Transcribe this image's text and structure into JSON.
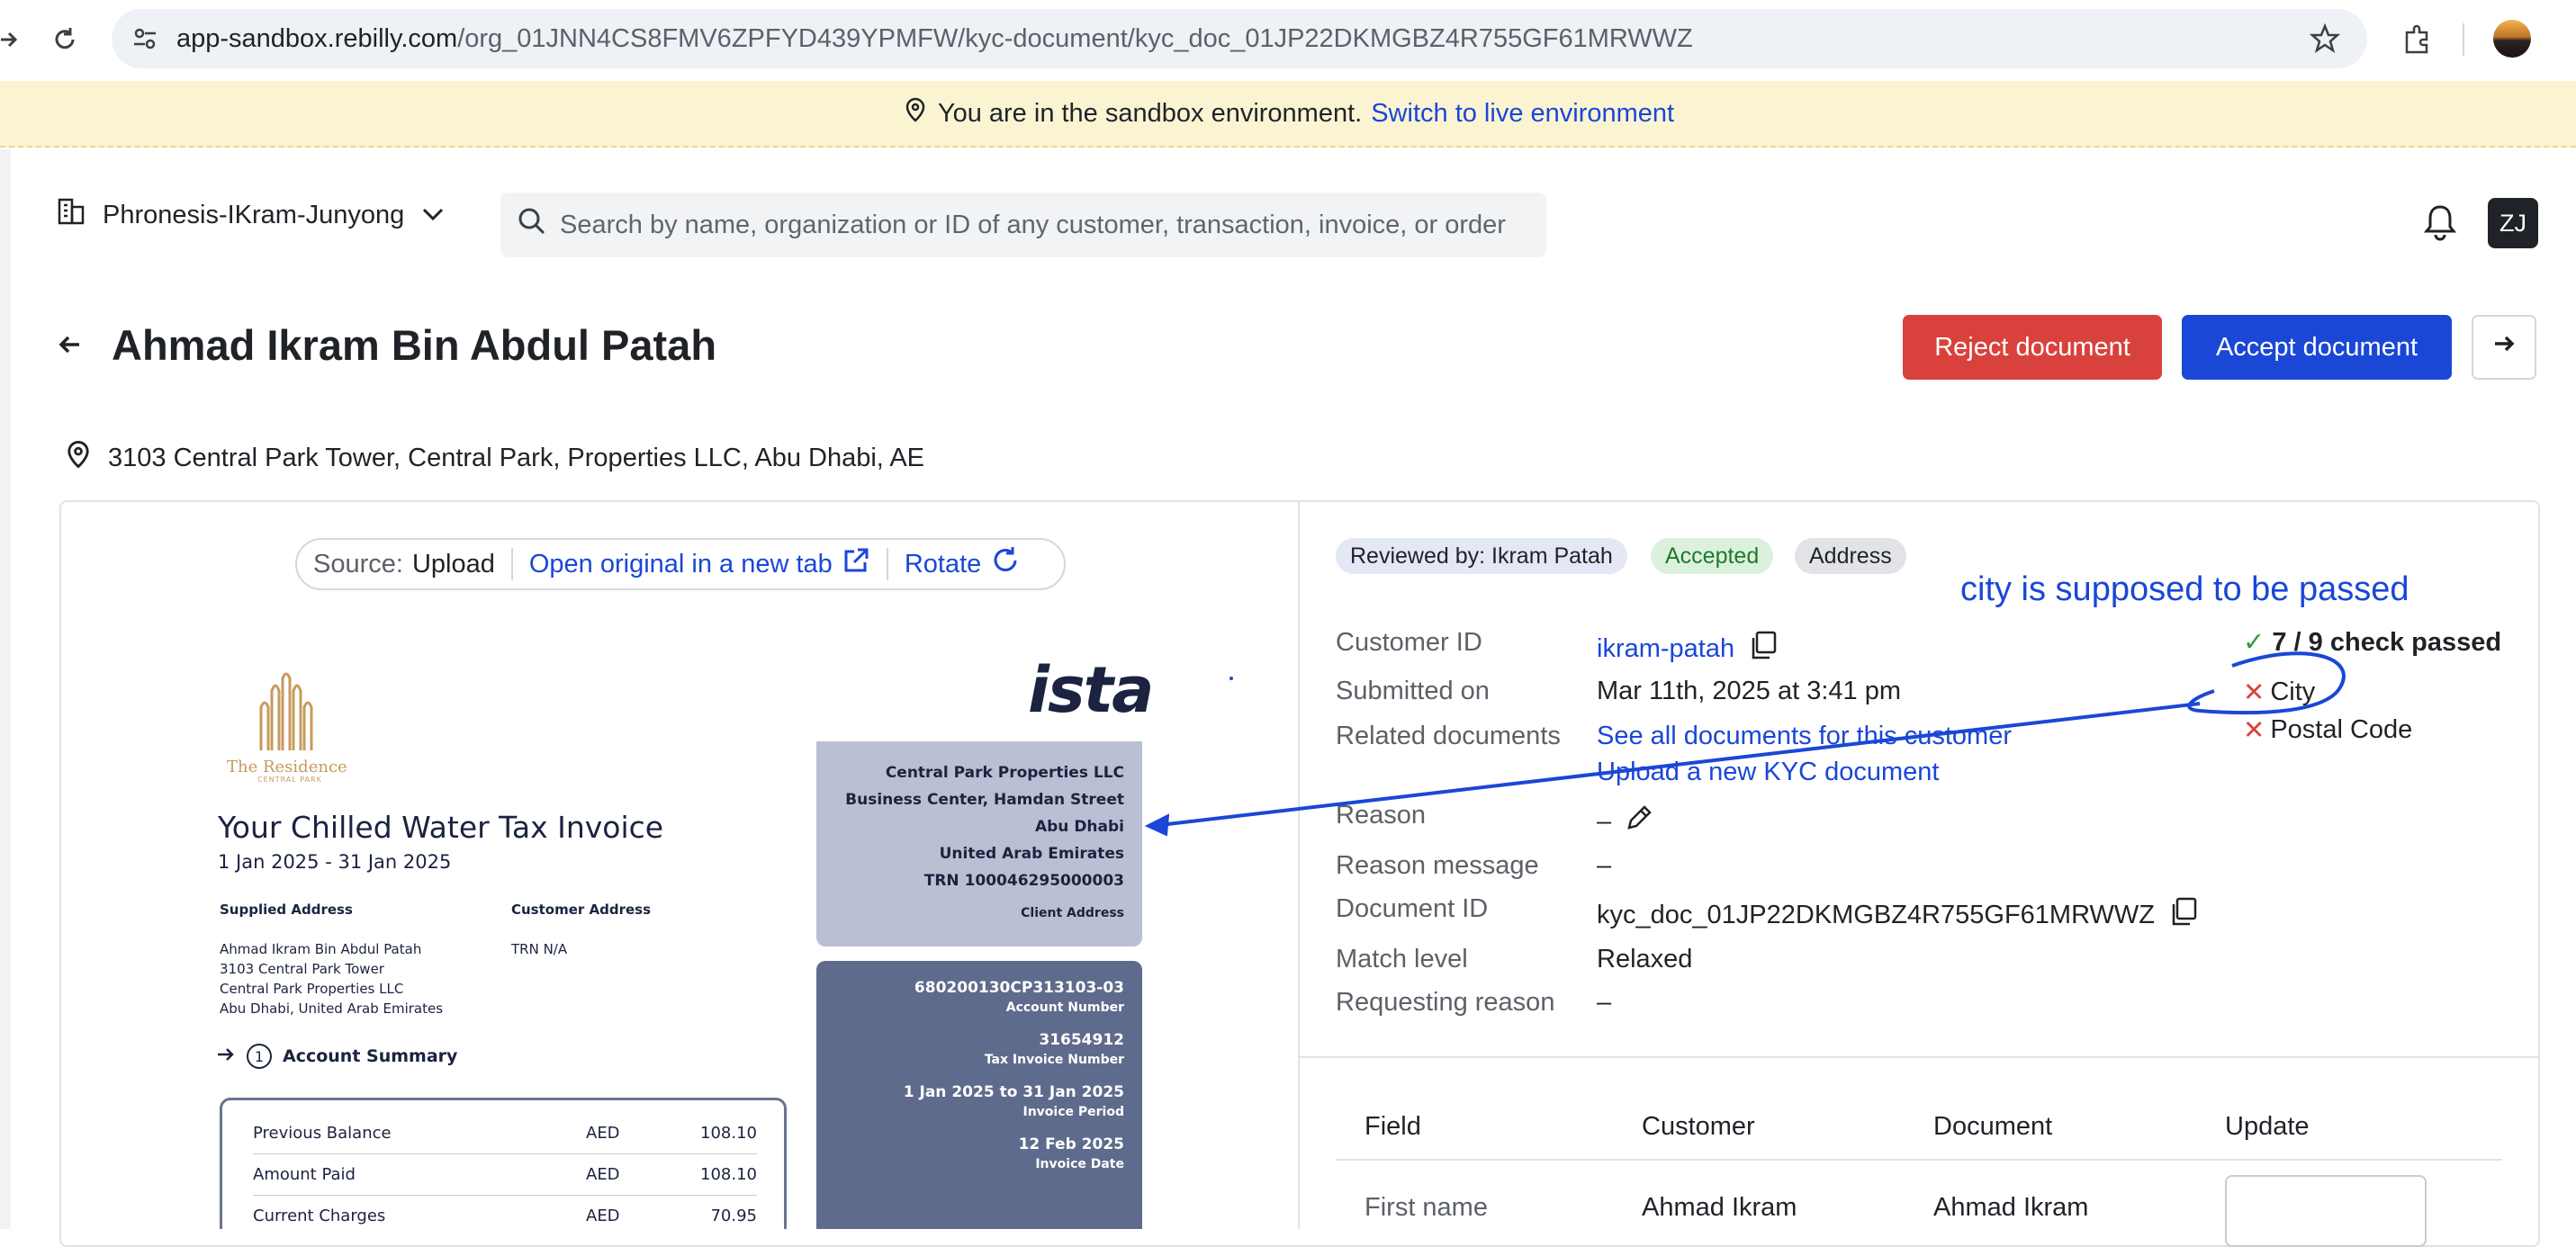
{
  "browser": {
    "url_host": "app-sandbox.rebilly.com",
    "url_path": "/org_01JNN4CS8FMV6ZPFYD439YPMFW/kyc-document/kyc_doc_01JP22DKMGBZ4R755GF61MRWWZ"
  },
  "banner": {
    "text": "You are in the sandbox environment.",
    "link": "Switch to live environment"
  },
  "topbar": {
    "org_name": "Phronesis-IKram-Junyong",
    "search_placeholder": "Search by name, organization or ID of any customer, transaction, invoice, or order",
    "avatar_initials": "ZJ"
  },
  "header": {
    "title": "Ahmad Ikram Bin Abdul Patah",
    "reject_label": "Reject document",
    "accept_label": "Accept document",
    "address": "3103 Central Park Tower, Central Park, Properties LLC, Abu Dhabi, AE"
  },
  "viewer": {
    "source_label": "Source:",
    "source_value": "Upload",
    "open_original": "Open original in a new tab",
    "rotate": "Rotate"
  },
  "invoice": {
    "logo_name": "The Residence",
    "logo_sub": "CENTRAL PARK",
    "brand": "ista",
    "title": "Your Chilled Water Tax Invoice",
    "period": "1 Jan 2025 - 31 Jan 2025",
    "supplied_address_h": "Supplied Address",
    "customer_address_h": "Customer Address",
    "supplied_address": [
      "Ahmad Ikram Bin Abdul Patah",
      "3103 Central Park Tower",
      "Central Park Properties LLC",
      "Abu Dhabi, United Arab Emirates"
    ],
    "customer_address": "TRN N/A",
    "summary_num": "1",
    "summary_title": "Account Summary",
    "rows": [
      {
        "label": "Previous Balance",
        "cur": "AED",
        "amt": "108.10"
      },
      {
        "label": "Amount Paid",
        "cur": "AED",
        "amt": "108.10"
      },
      {
        "label": "Current Charges",
        "cur": "AED",
        "amt": "70.95"
      }
    ],
    "client_box": [
      "Central Park Properties LLC",
      "Business Center, Hamdan Street",
      "Abu Dhabi",
      "United Arab Emirates",
      "TRN 100046295000003"
    ],
    "client_caption": "Client Address",
    "acct": [
      {
        "v": "680200130CP313103-03",
        "cap": "Account Number"
      },
      {
        "v": "31654912",
        "cap": "Tax Invoice Number"
      },
      {
        "v": "1 Jan 2025 to 31 Jan 2025",
        "cap": "Invoice Period"
      },
      {
        "v": "12 Feb 2025",
        "cap": "Invoice Date"
      }
    ]
  },
  "details": {
    "badges": {
      "reviewed": "Reviewed by: Ikram Patah",
      "accepted": "Accepted",
      "address": "Address"
    },
    "labels": {
      "customer_id": "Customer ID",
      "submitted_on": "Submitted on",
      "related_documents": "Related documents",
      "reason": "Reason",
      "reason_message": "Reason message",
      "document_id": "Document ID",
      "match_level": "Match level",
      "requesting_reason": "Requesting reason"
    },
    "values": {
      "customer_id": "ikram-patah",
      "submitted_on": "Mar 11th, 2025 at 3:41 pm",
      "see_all_docs": "See all documents for this customer",
      "upload_new": "Upload a new KYC document",
      "reason": "–",
      "reason_message": "–",
      "document_id": "kyc_doc_01JP22DKMGBZ4R755GF61MRWWZ",
      "match_level": "Relaxed",
      "requesting_reason": "–"
    },
    "checks": {
      "summary": "7 / 9 check passed",
      "failed": [
        "City",
        "Postal Code"
      ]
    }
  },
  "annotation": {
    "text": "city is supposed to be passed",
    "color": "#1a47d6"
  },
  "comparison": {
    "headers": [
      "Field",
      "Customer",
      "Document",
      "Update"
    ],
    "rows": [
      {
        "field": "First name",
        "customer": "Ahmad Ikram",
        "document": "Ahmad Ikram"
      }
    ]
  },
  "colors": {
    "primary": "#1a47d6",
    "danger": "#d9423c",
    "success": "#2e9e3a",
    "banner_bg": "#fbf4d3"
  }
}
